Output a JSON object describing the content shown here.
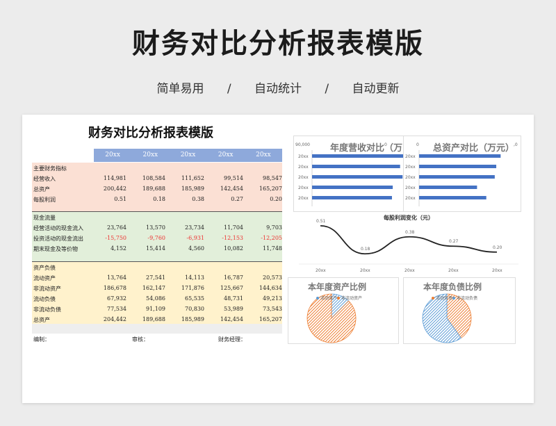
{
  "hero_title": "财务对比分析报表模版",
  "subtitle": [
    "简单易用",
    "/",
    "自动统计",
    "/",
    "自动更新"
  ],
  "sheet": {
    "title": "财务对比分析报表模版",
    "year_headers": [
      "20xx",
      "20xx",
      "20xx",
      "20xx",
      "20xx"
    ],
    "sections": [
      {
        "name": "主要财务指标",
        "rows": [
          {
            "label": "经营收入",
            "values": [
              "114,981",
              "108,584",
              "111,652",
              "99,514",
              "98,547"
            ]
          },
          {
            "label": "总资产",
            "values": [
              "200,442",
              "189,688",
              "185,989",
              "142,454",
              "165,207"
            ]
          },
          {
            "label": "每股利润",
            "values": [
              "0.51",
              "0.18",
              "0.38",
              "0.27",
              "0.20"
            ]
          }
        ]
      },
      {
        "name": "现金流量",
        "rows": [
          {
            "label": "经营活动的现金流入",
            "values": [
              "23,764",
              "13,570",
              "23,734",
              "11,704",
              "9,703"
            ]
          },
          {
            "label": "投资活动的现金流出",
            "values": [
              "-15,750",
              "-9,760",
              "-6,931",
              "-12,153",
              "-12,205"
            ]
          },
          {
            "label": "期末现金及等价物",
            "values": [
              "4,152",
              "15,414",
              "4,560",
              "10,082",
              "11,748"
            ]
          }
        ]
      },
      {
        "name": "资产负债",
        "rows": [
          {
            "label": "流动资产",
            "values": [
              "13,764",
              "27,541",
              "14,113",
              "16,787",
              "20,573"
            ]
          },
          {
            "label": "非流动资产",
            "values": [
              "186,678",
              "162,147",
              "171,876",
              "125,667",
              "144,634"
            ]
          },
          {
            "label": "流动负债",
            "values": [
              "67,932",
              "54,086",
              "65,535",
              "48,731",
              "49,213"
            ]
          },
          {
            "label": "非流动负债",
            "values": [
              "77,534",
              "91,109",
              "70,830",
              "53,989",
              "73,543"
            ]
          },
          {
            "label": "总资产",
            "values": [
              "204,442",
              "189,688",
              "185,989",
              "142,454",
              "165,207"
            ]
          }
        ]
      }
    ],
    "footer": {
      "editor": "编制：",
      "reviewer": "审核：",
      "manager": "财务经理："
    }
  },
  "chart_data": [
    {
      "type": "bar",
      "title": "年度营收对比（万",
      "categories": [
        "20xx",
        "20xx",
        "20xx",
        "20xx",
        "20xx"
      ],
      "values": [
        114981,
        108584,
        111652,
        99514,
        98547
      ],
      "xlim": [
        0,
        90000
      ],
      "tick_labels": [
        "90,000",
        "0"
      ],
      "color": "#4472c4"
    },
    {
      "type": "bar",
      "title": "总资产对比（万元）",
      "categories": [
        "20xx",
        "20xx",
        "20xx",
        "20xx",
        "20xx"
      ],
      "values": [
        200442,
        189688,
        185989,
        142454,
        165207
      ],
      "tick_labels": [
        "0",
        ",0"
      ],
      "color": "#4472c4"
    },
    {
      "type": "line",
      "title": "每股利润变化（元）",
      "categories": [
        "20xx",
        "20xx",
        "20xx",
        "20xx",
        "20xx"
      ],
      "values": [
        0.51,
        0.18,
        0.38,
        0.27,
        0.2
      ],
      "value_labels": [
        "0.51",
        "0.18",
        "0.38",
        "0.27",
        "0.20"
      ],
      "color": "#222222"
    },
    {
      "type": "pie",
      "title": "本年度资产比例",
      "labels": [
        "流动资产",
        "非流动资产"
      ],
      "values": [
        20573,
        144634
      ],
      "colors": [
        "#5b9bd5",
        "#ed7d31"
      ]
    },
    {
      "type": "pie",
      "title": "本年度负债比例",
      "labels": [
        "流动负债",
        "非流动负债"
      ],
      "values": [
        49213,
        73543
      ],
      "colors": [
        "#ed7d31",
        "#5b9bd5"
      ]
    }
  ]
}
